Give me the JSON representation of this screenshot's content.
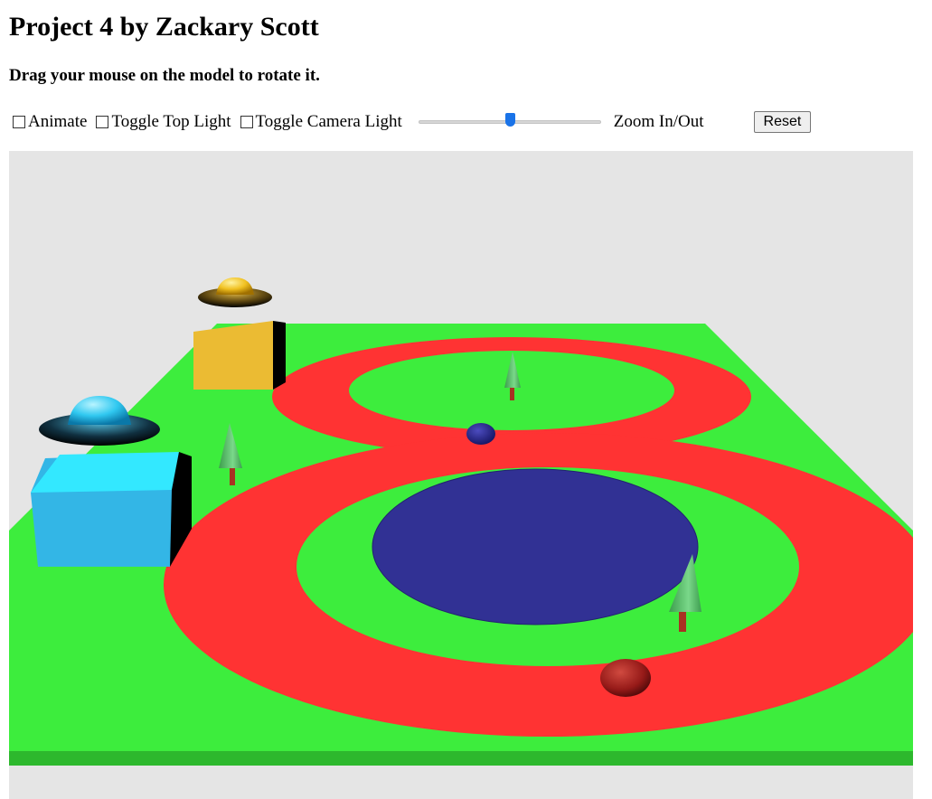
{
  "page": {
    "title": "Project 4 by Zackary Scott",
    "instructions": "Drag your mouse on the model to rotate it."
  },
  "controls": {
    "animate_label": "Animate",
    "animate_checked": false,
    "top_light_label": "Toggle Top Light",
    "top_light_checked": false,
    "camera_light_label": "Toggle Camera Light",
    "camera_light_checked": false,
    "zoom_label": "Zoom In/Out",
    "zoom_value_percent": 50,
    "reset_label": "Reset"
  },
  "scene": {
    "colors": {
      "background": "#e5e5e5",
      "ground": "#3ded3d",
      "ground_edge": "#2db82d",
      "track": "#ff3333",
      "pond": "#313194",
      "yellow_cube": "#ebbb33",
      "cyan_cube": "#33d6f5",
      "tree_foliage": "#5fcf6f",
      "tree_trunk": "#a83222",
      "red_ball": "#b3201e",
      "blue_ball": "#2a2a8c"
    },
    "icons": [
      "yellow-ufo-icon",
      "blue-ufo-icon",
      "tree-icon"
    ]
  }
}
